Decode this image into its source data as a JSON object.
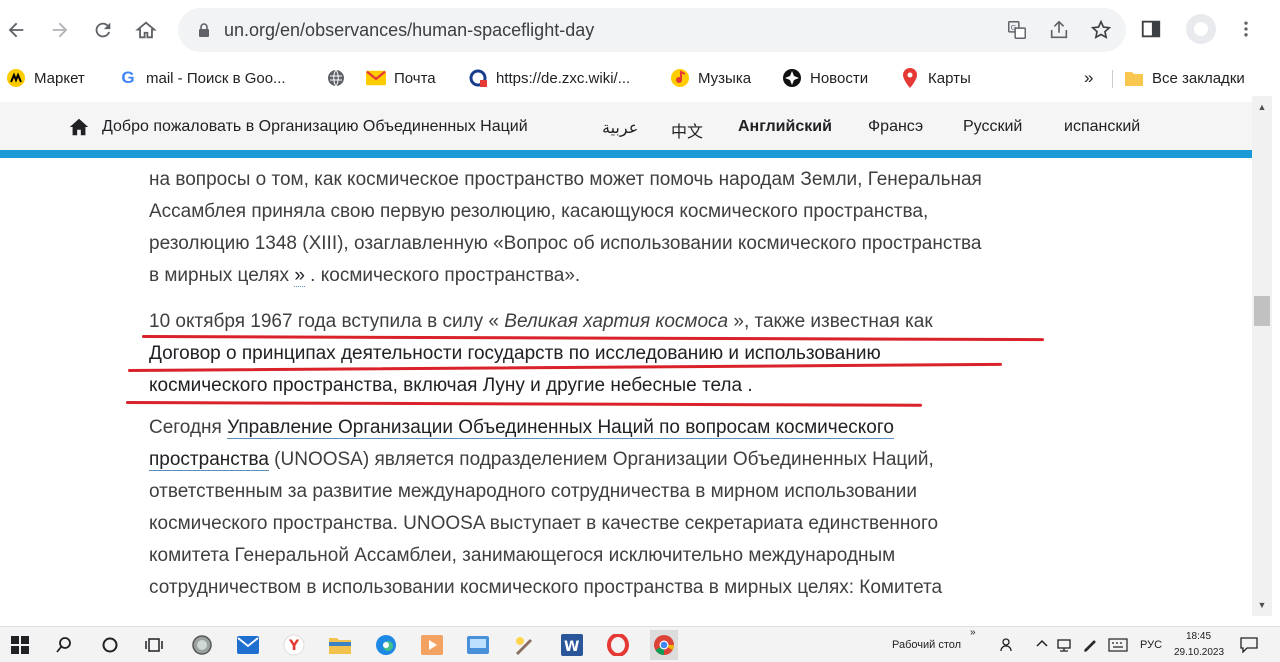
{
  "browser": {
    "url": "un.org/en/observances/human-spaceflight-day"
  },
  "bookmarks": [
    {
      "label": "Маркет",
      "icon": "yandex-market-icon"
    },
    {
      "label": "mail - Поиск в Goo...",
      "icon": "google-icon"
    },
    {
      "label": "",
      "icon": "globe-icon"
    },
    {
      "label": "Почта",
      "icon": "mail-icon"
    },
    {
      "label": "https://de.zxc.wiki/...",
      "icon": "zxc-wiki-icon"
    },
    {
      "label": "Музыка",
      "icon": "music-icon"
    },
    {
      "label": "Новости",
      "icon": "news-icon"
    },
    {
      "label": "Карты",
      "icon": "maps-pin-icon"
    }
  ],
  "bookmarks_more": "»",
  "bookmarks_all": "Все закладки",
  "un_header": {
    "welcome": "Добро пожаловать в Организацию Объединенных Наций",
    "languages": [
      "عربية",
      "中文",
      "Английский",
      "Франсэ",
      "Русский",
      "испанский"
    ],
    "active_language": "Английский"
  },
  "content": {
    "p1": [
      "на вопросы о том, как космическое пространство может помочь народам Земли, Генеральная",
      "Ассамблея приняла свою первую резолюцию, касающуюся космического пространства,",
      "резолюцию 1348 (XIII), озаглавленную «Вопрос об использовании космического пространства"
    ],
    "p1_last_a": "в мирных целях ",
    "p1_last_link": "»",
    "p1_last_b": " . космического пространства».",
    "p2_a": "10 октября 1967 года вступила в силу « ",
    "p2_italic": "Великая хартия космоса",
    "p2_b": " », также известная как",
    "p2_line2": "Договор о принципах деятельности государств по исследованию и использованию",
    "p2_line3_link": "космического пространства, включая Луну и другие небесные тела",
    "p2_line3_end": " .",
    "p3_a": "Сегодня ",
    "p3_link1": "Управление Организации Объединенных Наций по вопросам космического",
    "p3_link2": "пространства",
    "p3_l2_rest": " (UNOOSA) является подразделением Организации Объединенных Наций,",
    "p3_lines": [
      "ответственным за развитие международного сотрудничества в мирном использовании",
      "космического пространства. UNOOSA выступает в качестве секретариата единственного",
      "комитета Генеральной Ассамблеи, занимающегося исключительно международным",
      "сотрудничеством в использовании космического пространства в мирных целях: Комитета"
    ]
  },
  "taskbar": {
    "desktop_label": "Рабочий стол",
    "lang": "РУС",
    "time": "18:45",
    "date": "29.10.2023"
  },
  "colors": {
    "accent_blue": "#1a9ad6",
    "red_annotation": "#d9222a"
  }
}
